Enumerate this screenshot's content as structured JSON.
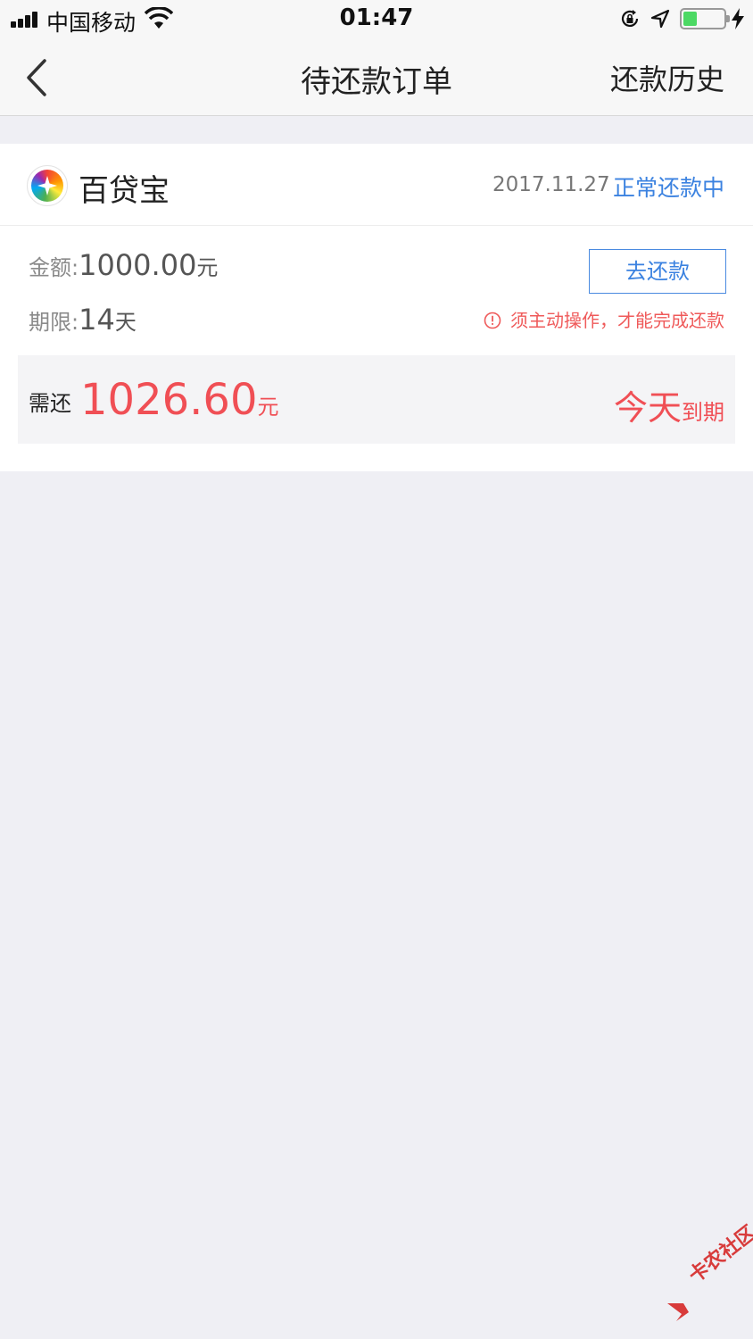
{
  "status_bar": {
    "carrier": "中国移动",
    "time": "01:47",
    "battery_level": 0.35,
    "colors": {
      "battery_fill": "#4cd964"
    }
  },
  "nav": {
    "back_icon": "chevron-left-icon",
    "title": "待还款订单",
    "history_label": "还款历史"
  },
  "order": {
    "app_name": "百贷宝",
    "date": "2017.11.27",
    "status": "正常还款中",
    "amount_label": "金额:",
    "amount_value": "1000.00",
    "amount_unit": "元",
    "term_label": "期限:",
    "term_value": "14",
    "term_unit": "天",
    "pay_button": "去还款",
    "warning": "须主动操作，才能完成还款",
    "due_label": "需还",
    "due_amount": "1026.60",
    "due_unit": "元",
    "due_today": "今天",
    "due_suffix": "到期"
  },
  "watermark": {
    "text": "卡农社区"
  },
  "colors": {
    "accent_blue": "#3b82e0",
    "alert_red": "#f04f55",
    "background": "#efeff4"
  }
}
